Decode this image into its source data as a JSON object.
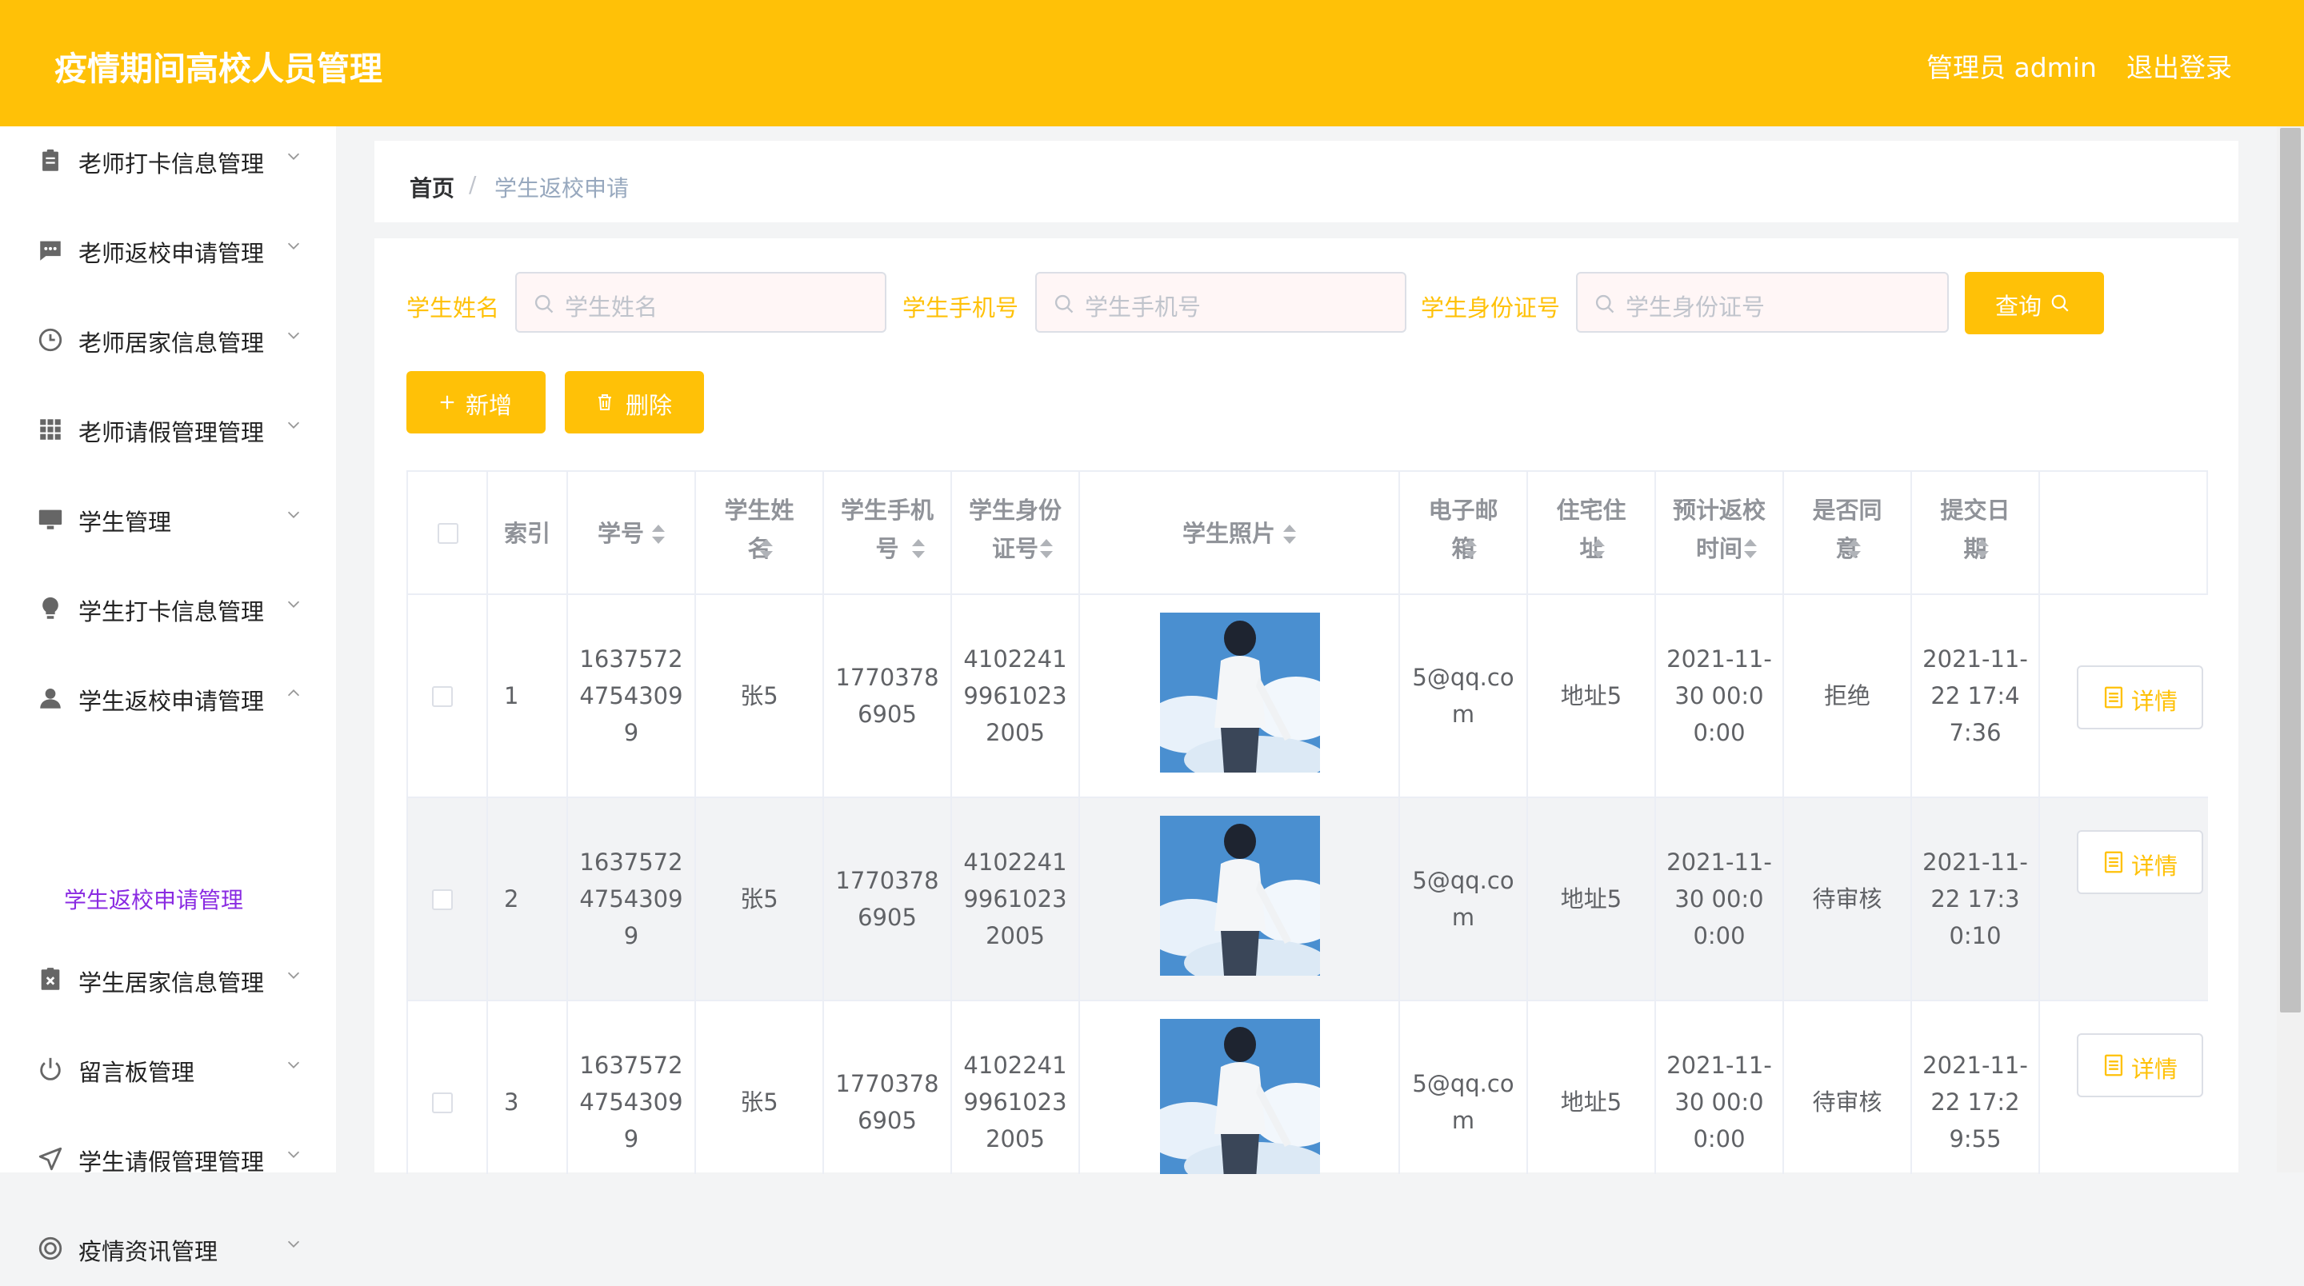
{
  "header": {
    "title": "疫情期间高校人员管理",
    "user": "管理员 admin",
    "logout": "退出登录"
  },
  "sidebar": {
    "items": [
      {
        "label": "老师打卡信息管理",
        "icon": "clipboard-icon",
        "expanded": false
      },
      {
        "label": "老师返校申请管理",
        "icon": "message-icon",
        "expanded": false
      },
      {
        "label": "老师居家信息管理",
        "icon": "clock-icon",
        "expanded": false
      },
      {
        "label": "老师请假管理管理",
        "icon": "grid-icon",
        "expanded": false
      },
      {
        "label": "学生管理",
        "icon": "monitor-icon",
        "expanded": false
      },
      {
        "label": "学生打卡信息管理",
        "icon": "bulb-icon",
        "expanded": false
      },
      {
        "label": "学生返校申请管理",
        "icon": "user-icon",
        "expanded": true
      },
      {
        "label": "学生居家信息管理",
        "icon": "delete-document-icon",
        "expanded": false
      },
      {
        "label": "留言板管理",
        "icon": "power-icon",
        "expanded": false
      },
      {
        "label": "学生请假管理管理",
        "icon": "send-icon",
        "expanded": false
      },
      {
        "label": "疫情资讯管理",
        "icon": "help-ring-icon",
        "expanded": false
      }
    ],
    "active_subitem": "学生返校申请管理"
  },
  "breadcrumb": {
    "home": "首页",
    "separator": "/",
    "current": "学生返校申请"
  },
  "search": {
    "name_label": "学生姓名",
    "name_placeholder": "学生姓名",
    "phone_label": "学生手机号",
    "phone_placeholder": "学生手机号",
    "id_label": "学生身份证号",
    "id_placeholder": "学生身份证号",
    "query_button": "查询"
  },
  "actions": {
    "add": "新增",
    "delete": "删除"
  },
  "table": {
    "columns": [
      "索引",
      "学号",
      "学生姓名",
      "学生手机号",
      "学生身份证号",
      "学生照片",
      "电子邮箱",
      "住宅住址",
      "预计返校时间",
      "是否同意",
      "提交日期"
    ],
    "rows": [
      {
        "index": "1",
        "student_no": "16375724754309 9",
        "name": "张5",
        "phone": "17703786905",
        "id_card": "410224199610232005",
        "email": "5@qq.com",
        "address": "地址5",
        "return_time": "2021-11-30 00:00:00",
        "approved": "拒绝",
        "submit_date": "2021-11-22 17:47:36",
        "detail": "详情"
      },
      {
        "index": "2",
        "student_no": "16375724754309 9",
        "name": "张5",
        "phone": "17703786905",
        "id_card": "410224199610232005",
        "email": "5@qq.com",
        "address": "地址5",
        "return_time": "2021-11-30 00:00:00",
        "approved": "待审核",
        "submit_date": "2021-11-22 17:30:10",
        "detail": "详情"
      },
      {
        "index": "3",
        "student_no": "16375724754309 9",
        "name": "张5",
        "phone": "17703786905",
        "id_card": "410224199610232005",
        "email": "5@qq.com",
        "address": "地址5",
        "return_time": "2021-11-30 00:00:00",
        "approved": "待审核",
        "submit_date": "2021-11-22 17:29:55",
        "detail": "详情"
      }
    ]
  },
  "colors": {
    "accent": "#ffc107",
    "submenu_active": "#8a2be2"
  }
}
